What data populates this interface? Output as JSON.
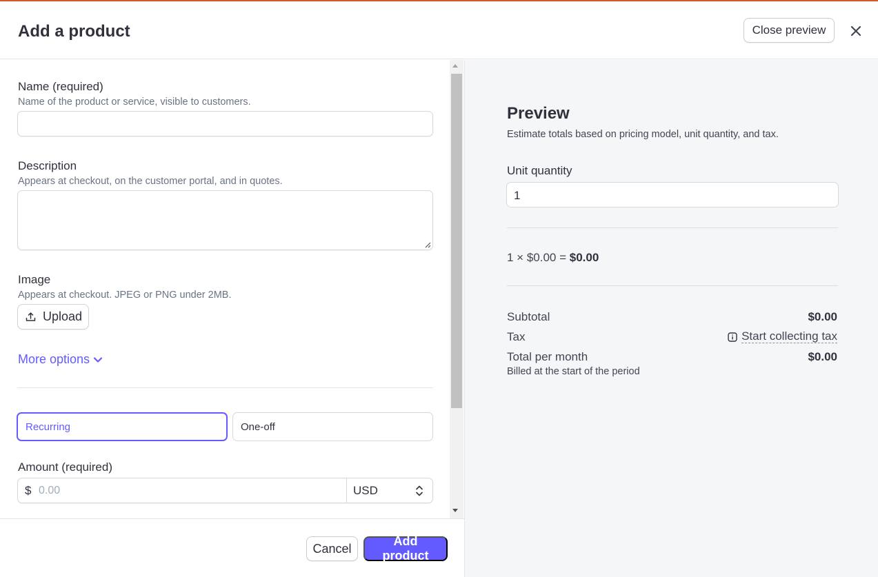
{
  "header": {
    "title": "Add a product",
    "close_preview_label": "Close preview"
  },
  "form": {
    "name": {
      "label": "Name (required)",
      "help": "Name of the product or service, visible to customers.",
      "value": ""
    },
    "description": {
      "label": "Description",
      "help": "Appears at checkout, on the customer portal, and in quotes.",
      "value": ""
    },
    "image": {
      "label": "Image",
      "help": "Appears at checkout. JPEG or PNG under 2MB.",
      "upload_label": "Upload"
    },
    "more_options_label": "More options",
    "pricing_type": {
      "options": [
        "Recurring",
        "One-off"
      ],
      "selected": "Recurring"
    },
    "amount": {
      "label": "Amount (required)",
      "currency_symbol": "$",
      "placeholder": "0.00",
      "currency": "USD"
    }
  },
  "footer": {
    "cancel_label": "Cancel",
    "add_label": "Add product"
  },
  "preview": {
    "title": "Preview",
    "subtitle": "Estimate totals based on pricing model, unit quantity, and tax.",
    "unit_quantity_label": "Unit quantity",
    "unit_quantity_value": "1",
    "calc_text": "1 × $0.00 = ",
    "calc_total": "$0.00",
    "subtotal_label": "Subtotal",
    "subtotal_value": "$0.00",
    "tax_label": "Tax",
    "tax_link": "Start collecting tax",
    "total_label": "Total per month",
    "total_value": "$0.00",
    "billed_note": "Billed at the start of the period"
  },
  "colors": {
    "accent": "#635bff",
    "top_border": "#cf5a2d",
    "preview_bg": "#f5f6f8"
  },
  "icons": [
    "close-icon",
    "upload-icon",
    "chevron-down-icon",
    "up-down-icon",
    "info-icon"
  ]
}
